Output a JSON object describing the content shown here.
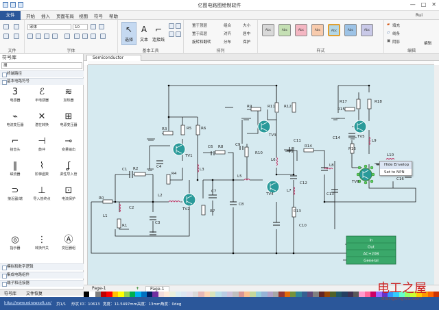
{
  "window": {
    "title": "亿图电路图绘制软件",
    "controls": [
      "—",
      "□",
      "✕"
    ]
  },
  "menu": {
    "file": "文件",
    "items": [
      "开始",
      "插入",
      "页面布局",
      "视图",
      "符号",
      "帮助"
    ],
    "user": "Rui"
  },
  "ribbon": {
    "groups": [
      "文件",
      "字体",
      "基本工具",
      "排列",
      "样式",
      "编辑"
    ],
    "font_name": "宋体",
    "font_size": "10",
    "tools": {
      "select": "选择",
      "text": "文本",
      "connector": "连接线"
    },
    "arrange": [
      "置于顶层",
      "置于底层",
      "旋转和翻转",
      "组合",
      "对齐",
      "大小",
      "居中",
      "分布",
      "保护"
    ],
    "style_swatches": [
      "Abc",
      "Abc",
      "Abc",
      "Abc",
      "Abc",
      "Abc",
      "Abc"
    ],
    "fill": "填充",
    "line": "线条",
    "shadow": "阴影",
    "edit": "编辑"
  },
  "library": {
    "title": "符号库",
    "search_placeholder": "搜",
    "categories_top": [
      "终端路径",
      "基本电路符号"
    ],
    "symbols": [
      "电感器",
      "半电感器",
      "加热器",
      "电流变压器",
      "潜在转换",
      "电源变压器",
      "拾音头",
      "鼓冲",
      "变量输出",
      "磁流器",
      "阶梯函数",
      "柔性导入管",
      "接近器/端",
      "导入管终点",
      "电流保护",
      "",
      "",
      "",
      "指示器",
      "转换开关",
      "变压器组"
    ],
    "categories_bottom": [
      "模拟和数字逻辑",
      "集成电路组件",
      "端子和连接器"
    ],
    "tabs": [
      "符号库",
      "文件恢复"
    ]
  },
  "doc": {
    "tab": "Semiconductor Electron"
  },
  "circuit": {
    "labels": [
      "R0",
      "L1",
      "R1",
      "C1",
      "R2",
      "C2",
      "C3",
      "L2",
      "TV2",
      "R3",
      "R4",
      "C4",
      "R5",
      "R6",
      "TV1",
      "L3",
      "C6",
      "R8",
      "C7",
      "R7",
      "C8",
      "L5",
      "C9",
      "R9",
      "R10",
      "R11",
      "R12",
      "TV3",
      "L6",
      "TV4",
      "L7",
      "R13",
      "C10",
      "C11",
      "R14",
      "C12",
      "C13",
      "C14",
      "L8",
      "R15",
      "R16",
      "R17",
      "R18",
      "TV5",
      "L9",
      "L10",
      "TV6",
      "C16"
    ],
    "table_rows": [
      "In",
      "Out",
      "AC+20B",
      "General"
    ]
  },
  "context_menu": {
    "items": [
      "Hide Envelop",
      "Set to NPN"
    ]
  },
  "pages": {
    "left": "Page-1",
    "add": "+",
    "active": "Page-1"
  },
  "palette": [
    "#000000",
    "#ffffff",
    "#7f7f7f",
    "#c00000",
    "#ff0000",
    "#ffc000",
    "#ffff00",
    "#92d050",
    "#00b050",
    "#00b0f0",
    "#0070c0",
    "#002060",
    "#7030a0",
    "#f2dcdb",
    "#fde9d9",
    "#ebf1dd",
    "#dbeef3",
    "#dce6f1",
    "#e5e0ec",
    "#d9d9d9",
    "#e6b8b7",
    "#fcd5b4",
    "#d8e4bc",
    "#b7dee8",
    "#b8cce4",
    "#ccc0da",
    "#bfbfbf",
    "#da9694",
    "#fabf8f",
    "#c4d79b",
    "#92cddc",
    "#95b3d7",
    "#b1a0c7",
    "#a6a6a6",
    "#963634",
    "#e26b0a",
    "#76933c",
    "#31869b",
    "#366092",
    "#60497a",
    "#808080",
    "#632523",
    "#974706",
    "#4f6228",
    "#205867",
    "#244062",
    "#3f3151",
    "#595959",
    "#ff99cc",
    "#ff6699",
    "#cc0066",
    "#9966ff",
    "#6633cc",
    "#3399ff",
    "#33ccff",
    "#66ffcc",
    "#99ff66",
    "#ccff33",
    "#ffcc00",
    "#ff9900",
    "#ff6600",
    "#cc3300"
  ],
  "status": {
    "url": "http://www.edrawsoft.cn/",
    "page": "页1/1",
    "shape": "形状 ID：10613",
    "width": "宽度：11.5497mm",
    "height": "高度：13mm",
    "angle": "角度：0deg"
  },
  "watermark": {
    "big": "电工之屋",
    "small": "diangongwu.com"
  }
}
